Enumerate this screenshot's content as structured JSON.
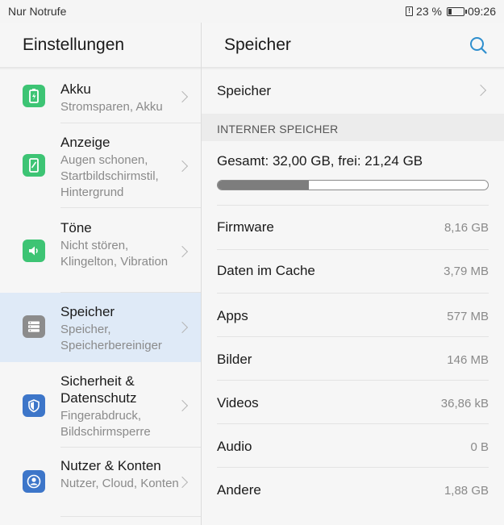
{
  "status_bar": {
    "carrier": "Nur Notrufe",
    "battery_percent": "23 %",
    "time": "09:26"
  },
  "left_pane": {
    "title": "Einstellungen",
    "items": [
      {
        "title": "Akku",
        "subtitle": "Stromsparen, Akku",
        "icon": "battery-icon",
        "color": "#3dc474"
      },
      {
        "title": "Anzeige",
        "subtitle": "Augen schonen, Startbildschirmstil, Hintergrund",
        "icon": "display-icon",
        "color": "#3dc474"
      },
      {
        "title": "Töne",
        "subtitle": "Nicht stören, Klingelton, Vibration",
        "icon": "speaker-icon",
        "color": "#3dc474"
      },
      {
        "title": "Speicher",
        "subtitle": "Speicher, Speicherbereiniger",
        "icon": "storage-icon",
        "color": "#8c8c8c",
        "active": true
      },
      {
        "title": "Sicherheit & Datenschutz",
        "subtitle": "Fingerabdruck, Bildschirmsperre",
        "icon": "shield-icon",
        "color": "#3d76c9"
      },
      {
        "title": "Nutzer & Konten",
        "subtitle": "Nutzer, Cloud, Konten",
        "icon": "user-icon",
        "color": "#3d76c9"
      }
    ]
  },
  "right_pane": {
    "title": "Speicher",
    "top_item": "Speicher",
    "section_header": "INTERNER SPEICHER",
    "summary": "Gesamt: 32,00 GB, frei: 21,24 GB",
    "used_fraction": 0.336,
    "rows": [
      {
        "label": "Firmware",
        "value": "8,16 GB"
      },
      {
        "label": "Daten im Cache",
        "value": "3,79 MB"
      },
      {
        "label": "Apps",
        "value": "577 MB"
      },
      {
        "label": "Bilder",
        "value": "146 MB"
      },
      {
        "label": "Videos",
        "value": "36,86 kB"
      },
      {
        "label": "Audio",
        "value": "0 B"
      },
      {
        "label": "Andere",
        "value": "1,88 GB"
      }
    ]
  },
  "colors": {
    "accent": "#2f8fce",
    "active_bg": "#dfeaf7"
  }
}
